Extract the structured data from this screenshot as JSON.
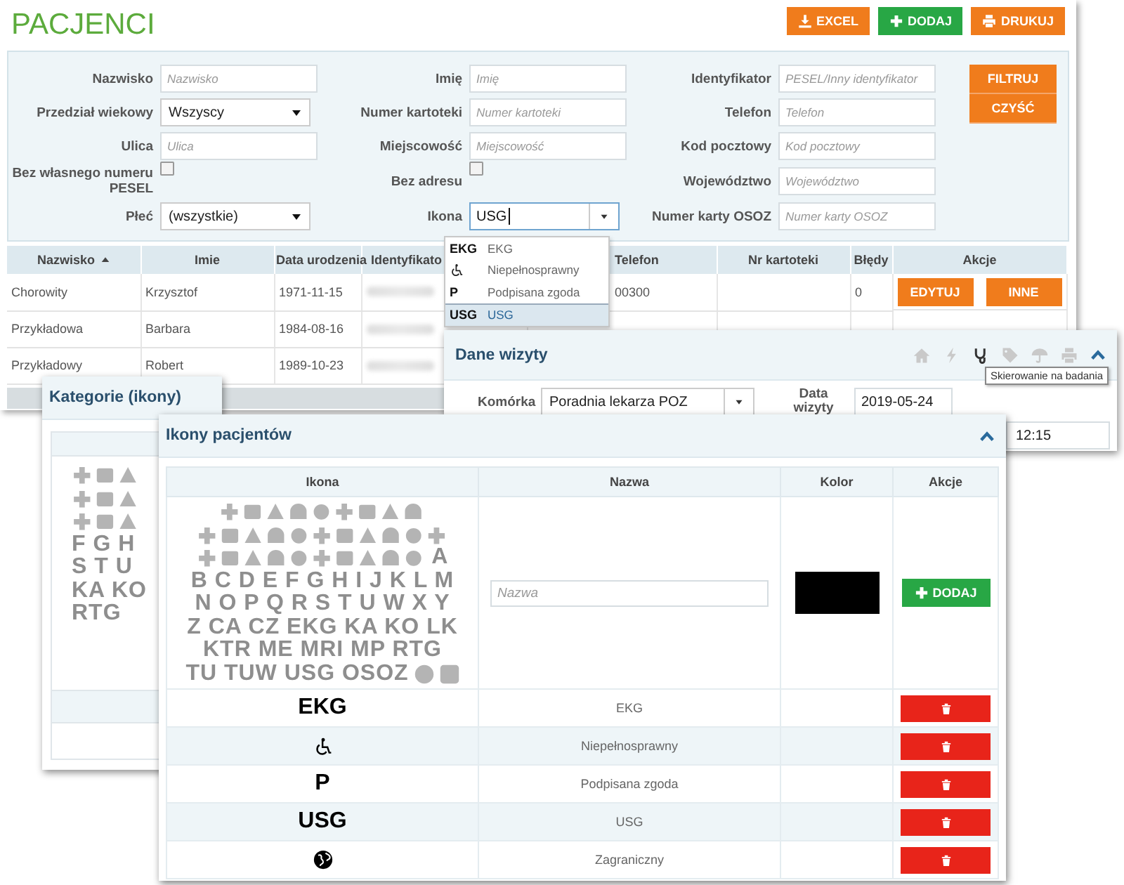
{
  "page": {
    "title": "PACJENCI",
    "buttons": [
      {
        "label": "EXCEL",
        "kind": "excel"
      },
      {
        "label": "DODAJ",
        "kind": "add"
      },
      {
        "label": "DRUKUJ",
        "kind": "print"
      }
    ]
  },
  "filters": {
    "fields": [
      {
        "label": "Nazwisko",
        "kind": "text",
        "placeholder": "Nazwisko"
      },
      {
        "label": "Imię",
        "kind": "text",
        "placeholder": "Imię"
      },
      {
        "label": "Identyfikator",
        "kind": "text",
        "placeholder": "PESEL/Inny identyfikator"
      },
      {
        "label": "Przedział wiekowy",
        "kind": "select",
        "value": "Wszyscy"
      },
      {
        "label": "Numer kartoteki",
        "kind": "text",
        "placeholder": "Numer kartoteki"
      },
      {
        "label": "Telefon",
        "kind": "text",
        "placeholder": "Telefon"
      },
      {
        "label": "Ulica",
        "kind": "text",
        "placeholder": "Ulica"
      },
      {
        "label": "Miejscowość",
        "kind": "text",
        "placeholder": "Miejscowość"
      },
      {
        "label": "Kod pocztowy",
        "kind": "text",
        "placeholder": "Kod pocztowy"
      },
      {
        "label": "Bez własnego numeru PESEL",
        "kind": "checkbox",
        "checked": false
      },
      {
        "label": "Bez adresu",
        "kind": "checkbox",
        "checked": false
      },
      {
        "label": "Województwo",
        "kind": "text",
        "placeholder": "Województwo"
      },
      {
        "label": "Płeć",
        "kind": "select",
        "value": "(wszystkie)"
      },
      {
        "label": "Ikona",
        "kind": "combo",
        "value": "USG"
      },
      {
        "label": "Numer karty OSOZ",
        "kind": "text",
        "placeholder": "Numer karty OSOZ"
      }
    ],
    "buttons": [
      "FILTRUJ",
      "CZYŚĆ"
    ]
  },
  "patients_table": {
    "columns": [
      {
        "label": "Nazwisko",
        "sorted": true
      },
      {
        "label": "Imie",
        "sorted": false
      },
      {
        "label": "Data urodzenia",
        "sorted": false
      },
      {
        "label": "Identyfikato",
        "sorted": false
      },
      {
        "label": "Telefon",
        "sorted": false
      },
      {
        "label": "Nr kartoteki",
        "sorted": false
      },
      {
        "label": "Błędy",
        "sorted": false
      },
      {
        "label": "Akcje",
        "sorted": false
      }
    ],
    "rows": [
      {
        "cells": [
          "Chorowity",
          "Krzysztof",
          "1971-11-15"
        ],
        "id_blurred": true,
        "phone": "00300",
        "errors": "0",
        "actions": [
          "EDYTUJ",
          "INNE"
        ]
      },
      {
        "cells": [
          "Przykładowa",
          "Barbara",
          "1984-08-16"
        ],
        "id_blurred": true
      },
      {
        "cells": [
          "Przykładowy",
          "Robert",
          "1989-10-23"
        ],
        "id_blurred": true
      }
    ]
  },
  "icon_dropdown": {
    "options": [
      {
        "kind": "text",
        "code": "EKG",
        "label": "EKG",
        "selected": false
      },
      {
        "kind": "wheelchair",
        "label": "Niepełnosprawny",
        "selected": false
      },
      {
        "kind": "text",
        "code": "P",
        "label": "Podpisana zgoda",
        "selected": false
      },
      {
        "kind": "text",
        "code": "USG",
        "label": "USG",
        "selected": true
      }
    ]
  },
  "visit_panel": {
    "title": "Dane wizyty",
    "toolbar": [
      {
        "kind": "home",
        "active": false
      },
      {
        "kind": "bolt",
        "active": false
      },
      {
        "kind": "stethoscope",
        "active": true
      },
      {
        "kind": "tag",
        "active": false
      },
      {
        "kind": "umbrella",
        "active": false
      },
      {
        "kind": "print",
        "active": false
      }
    ],
    "tooltip": "Skierowanie na badania",
    "unit_label": "Komórka",
    "unit_value": "Poradnia lekarza POZ",
    "date_label": "Data wizyty",
    "date_value": "2019-05-24",
    "time_value": "12:15"
  },
  "categories_panel": {
    "title": "Kategorie (ikony)",
    "palette": [
      {
        "kind": "icons"
      },
      {
        "kind": "icons"
      },
      {
        "kind": "icons"
      },
      {
        "kind": "letters",
        "text": "F G H"
      },
      {
        "kind": "letters",
        "text": "S T U"
      },
      {
        "kind": "letters",
        "text": "KA KO"
      },
      {
        "kind": "letters",
        "text": "RTG"
      }
    ]
  },
  "icons_panel": {
    "title": "Ikony pacjentów",
    "columns": [
      "Ikona",
      "Nazwa",
      "Kolor",
      "Akcje"
    ],
    "new_row": {
      "palette": [
        {
          "kind": "icons"
        },
        {
          "kind": "icons"
        },
        {
          "kind": "icons",
          "text": "A"
        },
        {
          "kind": "letters",
          "text": "B C D E F G H I J K L M"
        },
        {
          "kind": "letters",
          "text": "N O P Q R S T U W X Y"
        },
        {
          "kind": "letters",
          "text": "Z CA CZ EKG KA KO LK"
        },
        {
          "kind": "letters",
          "text": "KTR ME MRI MP RTG"
        },
        {
          "kind": "letters_shapes",
          "text": "TU TUW USG OSOZ"
        }
      ],
      "name_placeholder": "Nazwa",
      "color": "#000000",
      "button": "DODAJ"
    },
    "rows": [
      {
        "kind": "text",
        "icon": "EKG",
        "name": "EKG"
      },
      {
        "kind": "wheelchair",
        "name": "Niepełnosprawny"
      },
      {
        "kind": "text",
        "icon": "P",
        "name": "Podpisana zgoda"
      },
      {
        "kind": "text",
        "icon": "USG",
        "name": "USG"
      },
      {
        "kind": "globe",
        "name": "Zagraniczny"
      }
    ]
  }
}
